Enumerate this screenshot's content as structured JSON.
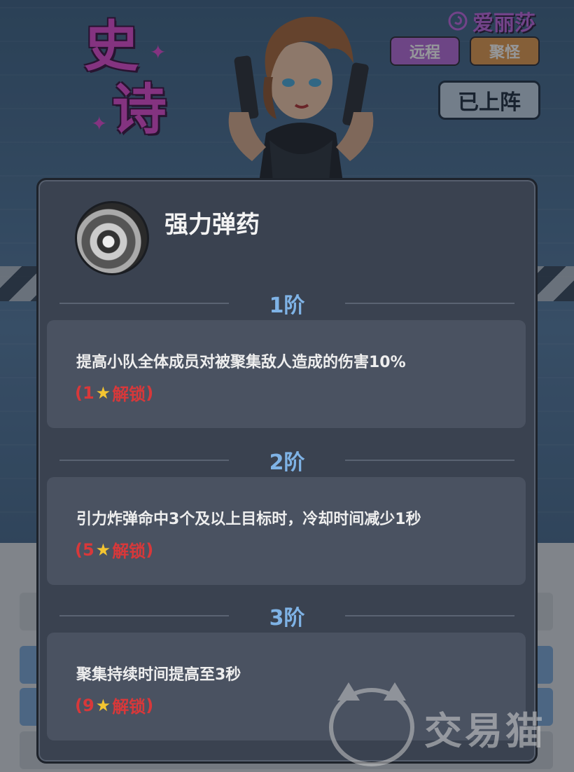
{
  "hero": {
    "rarity_char_1": "史",
    "rarity_char_2": "诗",
    "name": "爱丽莎",
    "tags": [
      "远程",
      "聚怪"
    ],
    "status": "已上阵"
  },
  "skill": {
    "title": "强力弹药",
    "tiers": [
      {
        "label": "1阶",
        "description": "提高小队全体成员对被聚集敌人造成的伤害10%",
        "unlock_open": "(",
        "unlock_stars": "1",
        "unlock_text": "解锁",
        "unlock_close": ")"
      },
      {
        "label": "2阶",
        "description": "引力炸弹命中3个及以上目标时，冷却时间减少1秒",
        "unlock_open": "(",
        "unlock_stars": "5",
        "unlock_text": "解锁",
        "unlock_close": ")"
      },
      {
        "label": "3阶",
        "description": "聚集持续时间提高至3秒",
        "unlock_open": "(",
        "unlock_stars": "9",
        "unlock_text": "解锁",
        "unlock_close": ")"
      }
    ]
  },
  "watermark": {
    "text": "交易猫"
  },
  "icons": {
    "skill": "ammo-drum-icon",
    "star": "star-icon",
    "faction": "swirl-icon",
    "watermark": "cat-logo-icon"
  },
  "colors": {
    "rarity": "#e04ad0",
    "tier_label": "#7fb3e6",
    "unlock_text": "#d8383a",
    "star": "#f4c531",
    "tag_ranged": "#b76ad9",
    "tag_gather": "#e29a4e"
  }
}
